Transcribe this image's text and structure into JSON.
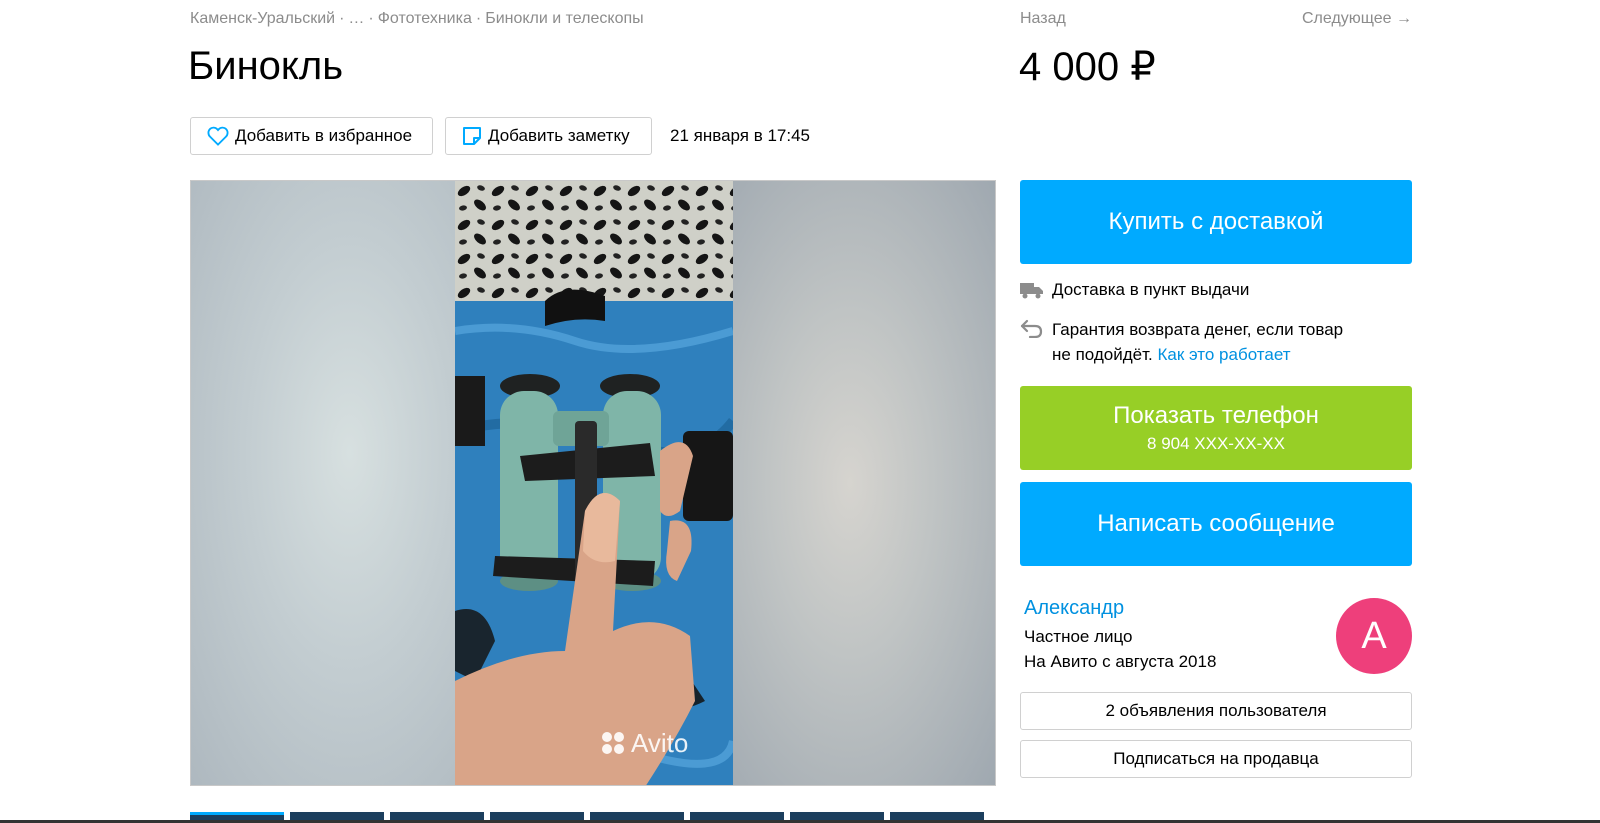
{
  "breadcrumbs": {
    "city": "Каменск-Уральский",
    "ellipsis": "…",
    "category": "Фототехника",
    "subcategory": "Бинокли и телескопы",
    "separator": "·"
  },
  "nav": {
    "back": "Назад",
    "next": "Следующее →"
  },
  "listing": {
    "title": "Бинокль",
    "price": "4 000 ₽",
    "date": "21 января в 17:45",
    "favorite_label": "Добавить в избранное",
    "note_label": "Добавить заметку"
  },
  "gallery": {
    "watermark": "Avito",
    "thumbnail_count": 8
  },
  "actions": {
    "buy_label": "Купить с доставкой",
    "delivery_text": "Доставка в пункт выдачи",
    "guarantee_text_1": "Гарантия возврата денег, если товар",
    "guarantee_text_2": "не подойдёт.",
    "guarantee_link": "Как это работает",
    "phone_label": "Показать телефон",
    "phone_number": "8 904 XXX-XX-XX",
    "message_label": "Написать сообщение"
  },
  "seller": {
    "name": "Александр",
    "type": "Частное лицо",
    "since": "На Авито с августа 2018",
    "avatar_letter": "А",
    "ads_label": "2 объявления пользователя",
    "subscribe_label": "Подписаться на продавца"
  },
  "colors": {
    "accent_blue": "#00aaff",
    "phone_green": "#97cf26",
    "link_blue": "#0091e0",
    "avatar_pink": "#ee3f7b"
  }
}
